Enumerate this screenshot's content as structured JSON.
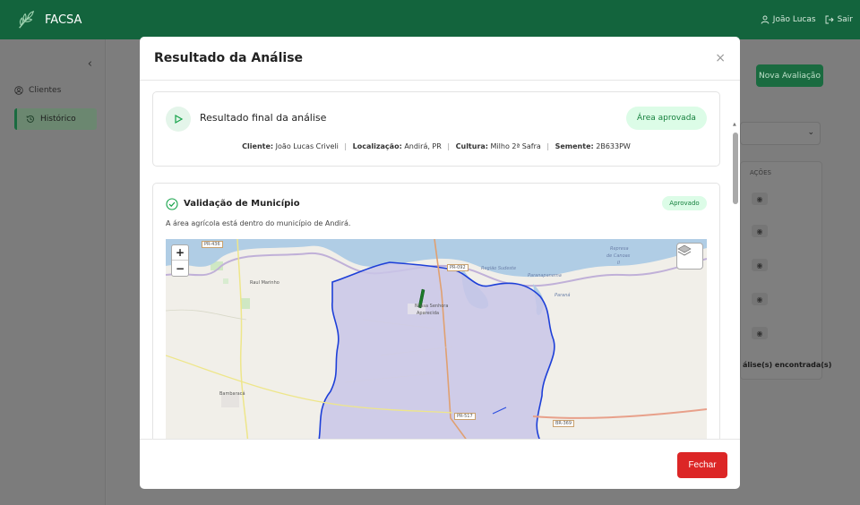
{
  "app": {
    "brand": "FACSA",
    "user": "João Lucas",
    "logout": "Sair"
  },
  "sidebar": {
    "collapse": "‹",
    "items": [
      {
        "label": "Clientes",
        "icon": "users-icon"
      },
      {
        "label": "Histórico",
        "icon": "history-icon"
      }
    ]
  },
  "background": {
    "new_eval_button": "Nova Avaliação",
    "actions_header": "AÇÕES",
    "count_text": "álise(s) encontrada(s)"
  },
  "modal": {
    "title": "Resultado da Análise",
    "close": "×",
    "result_card": {
      "title": "Resultado final da análise",
      "status": "Área aprovada",
      "cliente_label": "Cliente:",
      "cliente": "João Lucas Criveli",
      "localizacao_label": "Localização:",
      "localizacao": "Andirá, PR",
      "cultura_label": "Cultura:",
      "cultura": "Milho 2ª Safra",
      "semente_label": "Semente:",
      "semente": "2B633PW"
    },
    "validation_card": {
      "title": "Validação de Município",
      "status": "Aprovado",
      "description": "A área agrícola está dentro do município de Andirá."
    },
    "map": {
      "zoom_in": "+",
      "zoom_out": "−",
      "labels": {
        "raul_marinho": "Raul Marinho",
        "nossa_senhora": "Nossa Senhora",
        "aparecida": "Aparecida",
        "bambaraca": "Bambaracá",
        "represa": "Represa",
        "de_canoas": "de Canoas",
        "ii": "II",
        "regiao_sudeste": "Região Sudeste",
        "paranapanema": "Paranapanema",
        "parana": "Paraná"
      },
      "roads": {
        "pr436": "PR-436",
        "pr092": "PR-092",
        "pr517": "PR-517",
        "br369": "BR-369"
      }
    },
    "close_button": "Fechar"
  }
}
